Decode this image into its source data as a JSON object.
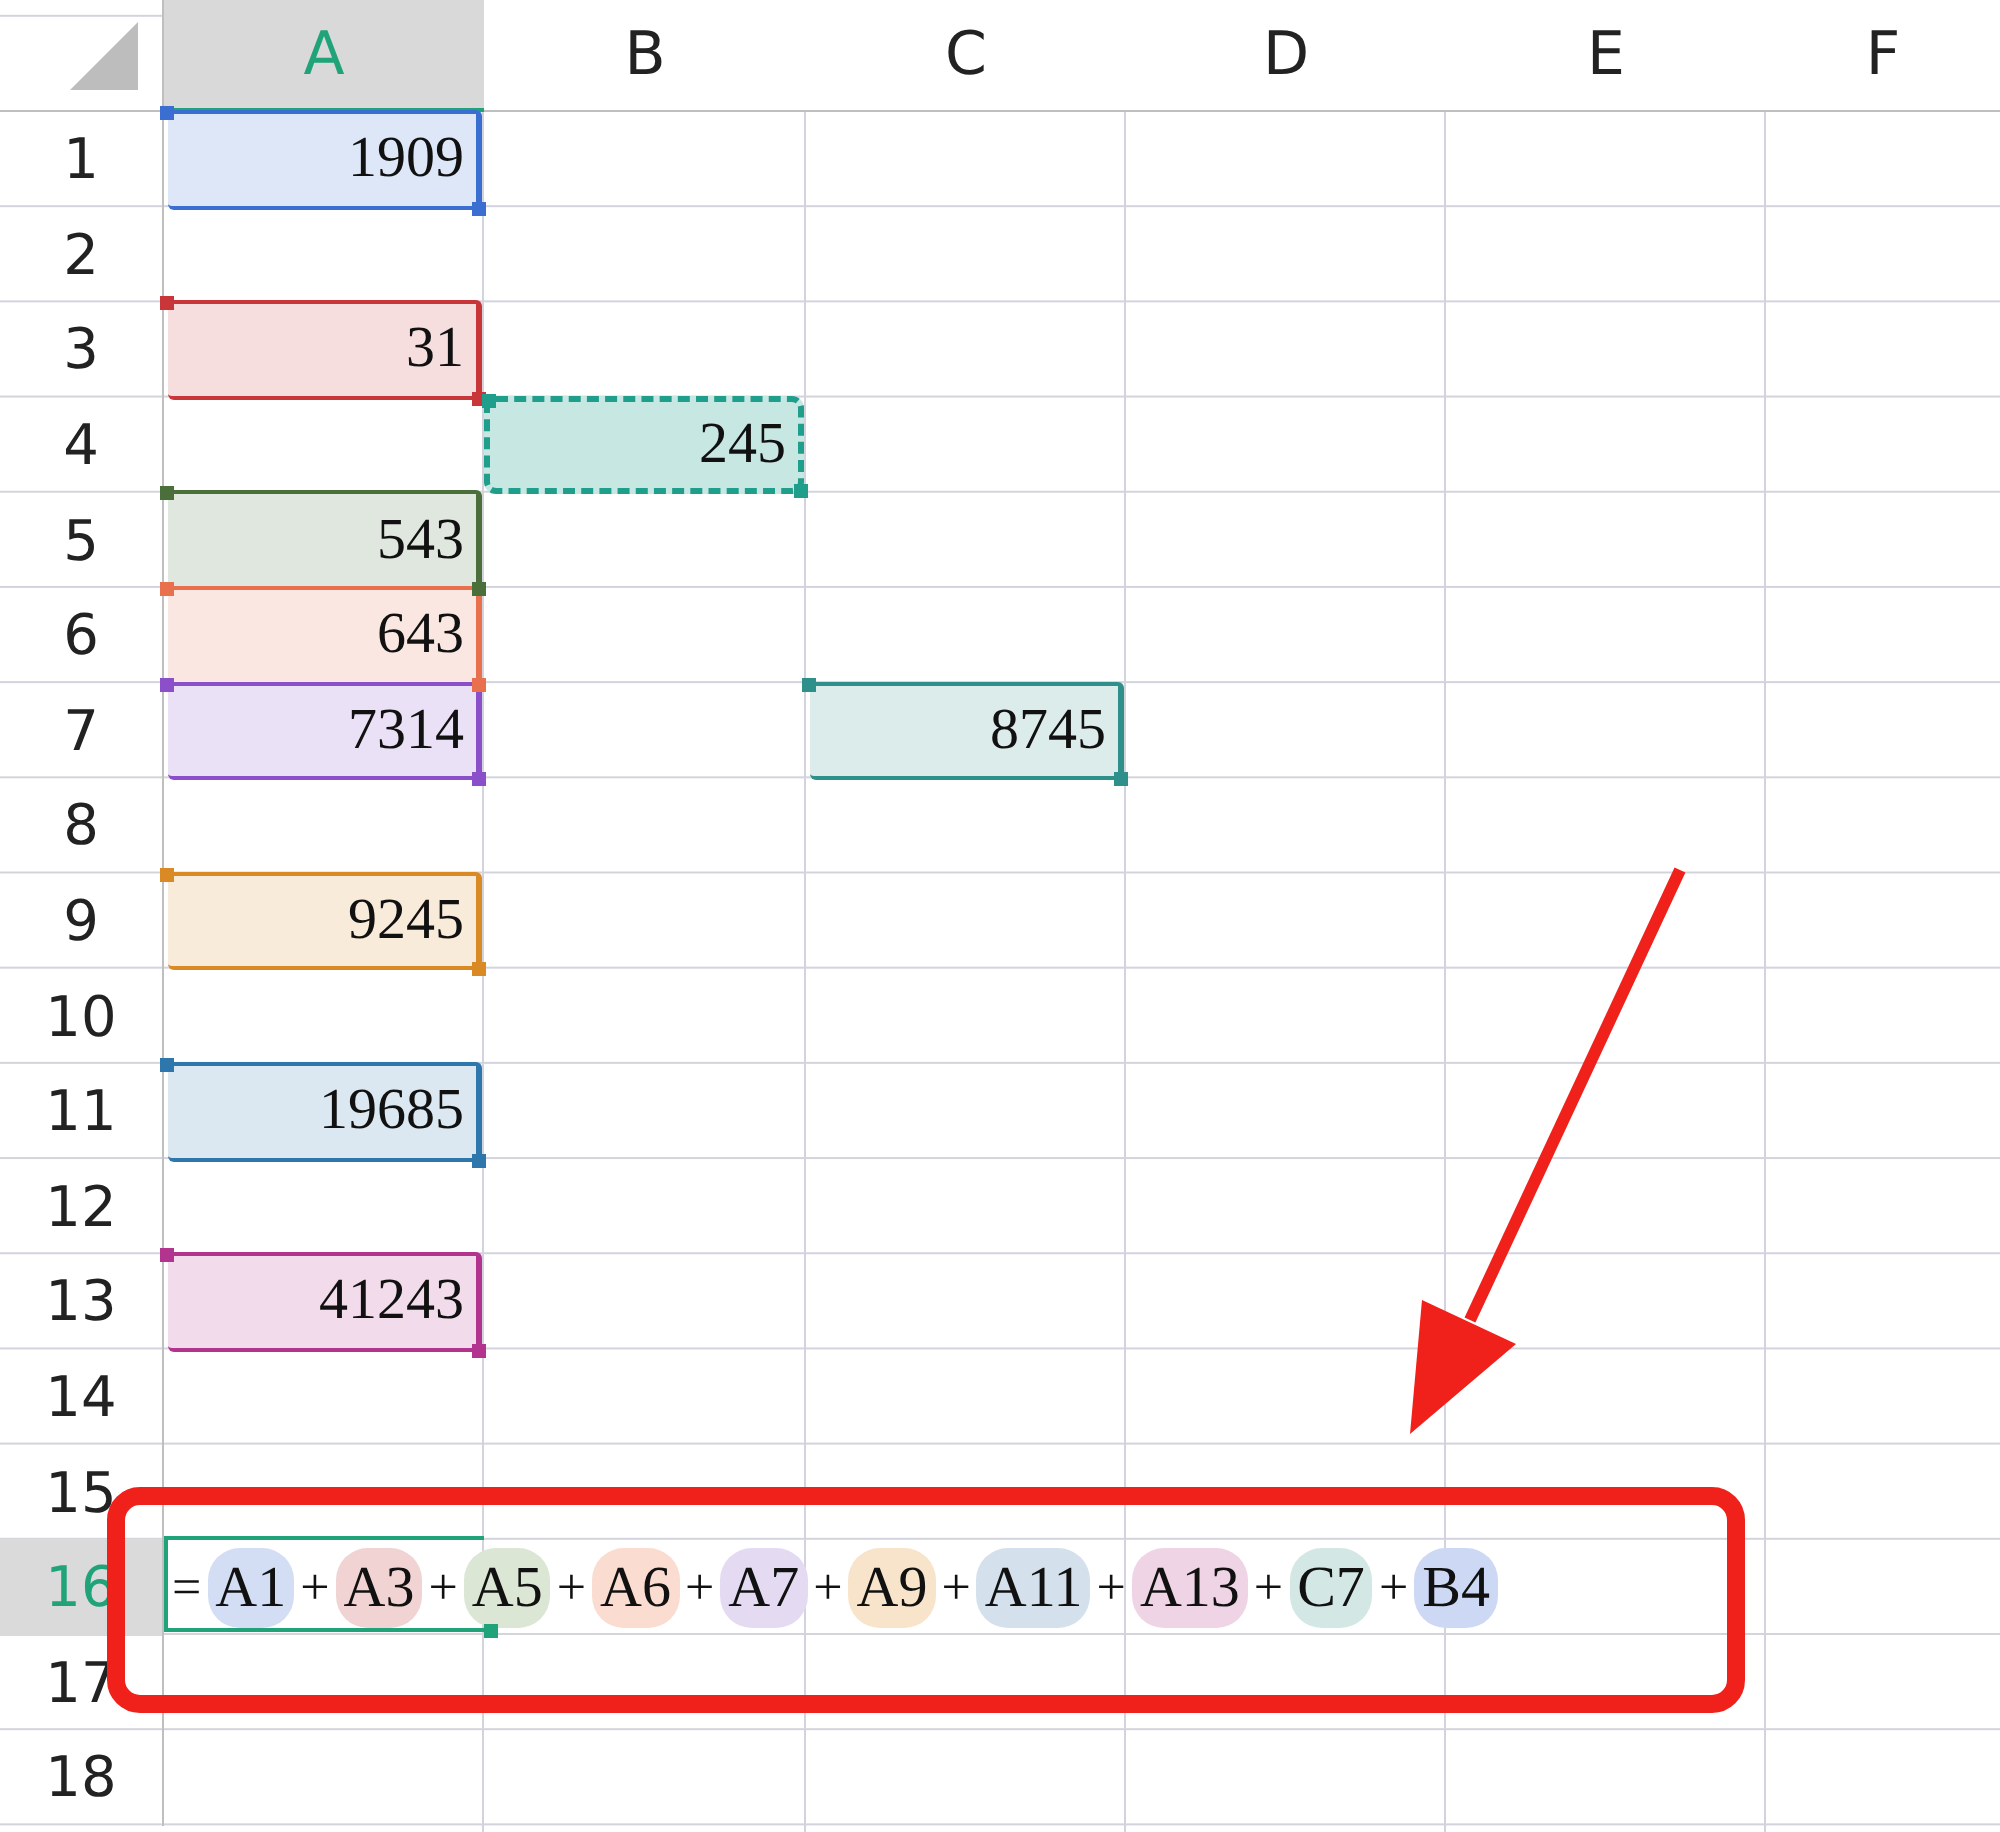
{
  "column_headers": [
    {
      "label": "A",
      "selected": true
    },
    {
      "label": "B",
      "selected": false
    },
    {
      "label": "C",
      "selected": false
    },
    {
      "label": "D",
      "selected": false
    },
    {
      "label": "E",
      "selected": false
    },
    {
      "label": "F",
      "selected": false
    }
  ],
  "rows": [
    {
      "header": "1",
      "selected": false,
      "cells": [
        {
          "value": "1909",
          "color": "#3a6fd1",
          "dashed": false
        },
        null,
        null,
        null,
        null,
        null
      ]
    },
    {
      "header": "2",
      "selected": false,
      "cells": [
        null,
        null,
        null,
        null,
        null,
        null
      ]
    },
    {
      "header": "3",
      "selected": false,
      "cells": [
        {
          "value": "31",
          "color": "#c8363a",
          "dashed": false
        },
        null,
        null,
        null,
        null,
        null
      ]
    },
    {
      "header": "4",
      "selected": false,
      "cells": [
        null,
        {
          "value": "245",
          "color": "#1f9e8c",
          "dashed": true
        },
        null,
        null,
        null,
        null
      ]
    },
    {
      "header": "5",
      "selected": false,
      "cells": [
        {
          "value": "543",
          "color": "#4b6f3a",
          "dashed": false
        },
        null,
        null,
        null,
        null,
        null
      ]
    },
    {
      "header": "6",
      "selected": false,
      "cells": [
        {
          "value": "643",
          "color": "#e8704c",
          "dashed": false
        },
        null,
        null,
        null,
        null,
        null
      ]
    },
    {
      "header": "7",
      "selected": false,
      "cells": [
        {
          "value": "7314",
          "color": "#8a4fc9",
          "dashed": false
        },
        null,
        {
          "value": "8745",
          "color": "#2f8f8a",
          "dashed": false
        },
        null,
        null,
        null
      ]
    },
    {
      "header": "8",
      "selected": false,
      "cells": [
        null,
        null,
        null,
        null,
        null,
        null
      ]
    },
    {
      "header": "9",
      "selected": false,
      "cells": [
        {
          "value": "9245",
          "color": "#d98a25",
          "dashed": false
        },
        null,
        null,
        null,
        null,
        null
      ]
    },
    {
      "header": "10",
      "selected": false,
      "cells": [
        null,
        null,
        null,
        null,
        null,
        null
      ]
    },
    {
      "header": "11",
      "selected": false,
      "cells": [
        {
          "value": "19685",
          "color": "#2e77ad",
          "dashed": false
        },
        null,
        null,
        null,
        null,
        null
      ]
    },
    {
      "header": "12",
      "selected": false,
      "cells": [
        null,
        null,
        null,
        null,
        null,
        null
      ]
    },
    {
      "header": "13",
      "selected": false,
      "cells": [
        {
          "value": "41243",
          "color": "#b2348f",
          "dashed": false
        },
        null,
        null,
        null,
        null,
        null
      ]
    },
    {
      "header": "14",
      "selected": false,
      "cells": [
        null,
        null,
        null,
        null,
        null,
        null
      ]
    },
    {
      "header": "15",
      "selected": false,
      "cells": [
        null,
        null,
        null,
        null,
        null,
        null
      ]
    },
    {
      "header": "16",
      "selected": true,
      "formula": {
        "tokens": [
          {
            "kind": "operator",
            "text": "="
          },
          {
            "kind": "reference",
            "text": "A1",
            "color": "#d3ddf3"
          },
          {
            "kind": "operator",
            "text": "+"
          },
          {
            "kind": "reference",
            "text": "A3",
            "color": "#f0d3d2"
          },
          {
            "kind": "operator",
            "text": "+"
          },
          {
            "kind": "reference",
            "text": "A5",
            "color": "#dbe6d4"
          },
          {
            "kind": "operator",
            "text": "+"
          },
          {
            "kind": "reference",
            "text": "A6",
            "color": "#fadcd0"
          },
          {
            "kind": "operator",
            "text": "+"
          },
          {
            "kind": "reference",
            "text": "A7",
            "color": "#e4dbf3"
          },
          {
            "kind": "operator",
            "text": "+"
          },
          {
            "kind": "reference",
            "text": "A9",
            "color": "#f8e4cb"
          },
          {
            "kind": "operator",
            "text": "+"
          },
          {
            "kind": "reference",
            "text": "A11",
            "color": "#d4e1ec"
          },
          {
            "kind": "operator",
            "text": "+"
          },
          {
            "kind": "reference",
            "text": "A13",
            "color": "#efd4e6"
          },
          {
            "kind": "operator",
            "text": "+"
          },
          {
            "kind": "reference",
            "text": "C7",
            "color": "#d3e8e4"
          },
          {
            "kind": "operator",
            "text": "+"
          },
          {
            "kind": "reference",
            "text": "B4",
            "color": "#cdd9f4"
          }
        ]
      }
    },
    {
      "header": "17",
      "selected": false,
      "cells": [
        null,
        null,
        null,
        null,
        null,
        null
      ]
    },
    {
      "header": "18",
      "selected": false,
      "cells": [
        null,
        null,
        null,
        null,
        null,
        null
      ]
    }
  ]
}
